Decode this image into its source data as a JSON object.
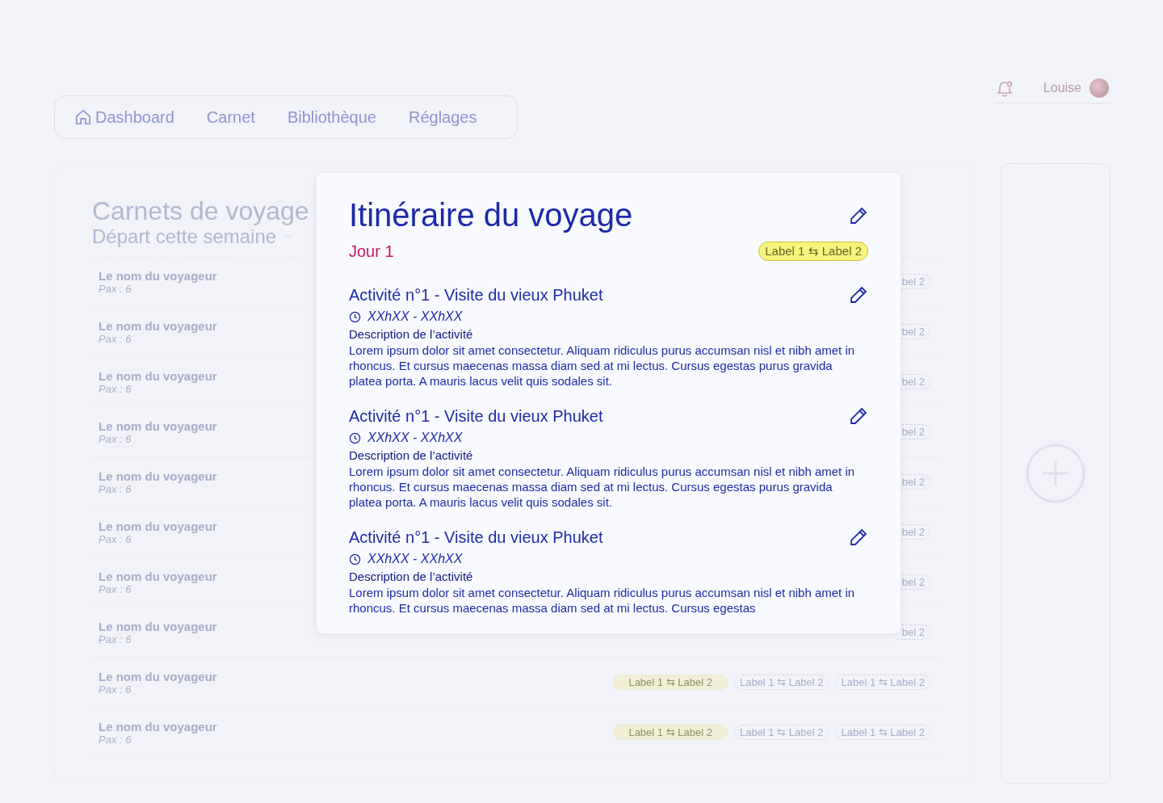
{
  "nav": {
    "items": [
      {
        "label": "Dashboard",
        "kind": "home"
      },
      {
        "label": "Carnet",
        "kind": "text"
      },
      {
        "label": "Bibliothèque",
        "kind": "text"
      },
      {
        "label": "Réglages",
        "kind": "text"
      }
    ]
  },
  "user": {
    "name": "Louise"
  },
  "list": {
    "title": "Carnets de voyage",
    "filter": "Départ cette semaine",
    "rows": [
      {
        "name": "Le nom du voyageur",
        "pax": "Pax : 6",
        "chips": [
          {
            "text": "bel 2",
            "kind": "cut"
          }
        ]
      },
      {
        "name": "Le nom du voyageur",
        "pax": "Pax : 6",
        "chips": [
          {
            "text": "bel 2",
            "kind": "cut"
          }
        ]
      },
      {
        "name": "Le nom du voyageur",
        "pax": "Pax : 6",
        "chips": [
          {
            "text": "bel 2",
            "kind": "cut"
          }
        ]
      },
      {
        "name": "Le nom du voyageur",
        "pax": "Pax : 6",
        "chips": [
          {
            "text": "bel 2",
            "kind": "cut"
          }
        ]
      },
      {
        "name": "Le nom du voyageur",
        "pax": "Pax : 6",
        "chips": [
          {
            "text": "bel 2",
            "kind": "cut"
          }
        ]
      },
      {
        "name": "Le nom du voyageur",
        "pax": "Pax : 6",
        "chips": [
          {
            "text": "bel 2",
            "kind": "cut"
          }
        ]
      },
      {
        "name": "Le nom du voyageur",
        "pax": "Pax : 6",
        "chips": [
          {
            "text": "bel 2",
            "kind": "cut"
          }
        ]
      },
      {
        "name": "Le nom du voyageur",
        "pax": "Pax : 6",
        "chips": [
          {
            "text": "bel 2",
            "kind": "cut"
          }
        ]
      },
      {
        "name": "Le nom du voyageur",
        "pax": "Pax : 6",
        "chips": [
          {
            "text": "Label 1 ⇆ Label 2",
            "kind": "yellow"
          },
          {
            "text": "Label 1 ⇆ Label 2",
            "kind": "outline"
          },
          {
            "text": "Label 1 ⇆ Label 2",
            "kind": "outline"
          }
        ]
      },
      {
        "name": "Le nom du voyageur",
        "pax": "Pax : 6",
        "chips": [
          {
            "text": "Label 1 ⇆ Label 2",
            "kind": "yellow"
          },
          {
            "text": "Label 1 ⇆ Label 2",
            "kind": "outline"
          },
          {
            "text": "Label 1 ⇆ Label 2",
            "kind": "outline"
          }
        ]
      }
    ]
  },
  "modal": {
    "title": "Itinéraire du voyage",
    "day": "Jour 1",
    "tag": "Label 1 ⇆ Label 2",
    "activities": [
      {
        "title": "Activité n°1 - Visite du vieux Phuket",
        "time": "XXhXX - XXhXX",
        "desc_title": "Description de l’activité",
        "text": "Lorem ipsum dolor sit amet consectetur. Aliquam ridiculus purus accumsan nisl et nibh amet in rhoncus. Et cursus maecenas massa diam sed at mi lectus. Cursus egestas purus gravida platea porta. A mauris lacus velit quis sodales sit."
      },
      {
        "title": "Activité n°1 - Visite du vieux Phuket",
        "time": "XXhXX - XXhXX",
        "desc_title": "Description de l’activité",
        "text": "Lorem ipsum dolor sit amet consectetur. Aliquam ridiculus purus accumsan nisl et nibh amet in rhoncus. Et cursus maecenas massa diam sed at mi lectus. Cursus egestas purus gravida platea porta. A mauris lacus velit quis sodales sit."
      },
      {
        "title": "Activité n°1 - Visite du vieux Phuket",
        "time": "XXhXX - XXhXX",
        "desc_title": "Description de l’activité",
        "text": "Lorem ipsum dolor sit amet consectetur. Aliquam ridiculus purus accumsan nisl et nibh amet in rhoncus. Et cursus maecenas massa diam sed at mi lectus. Cursus egestas"
      }
    ]
  }
}
